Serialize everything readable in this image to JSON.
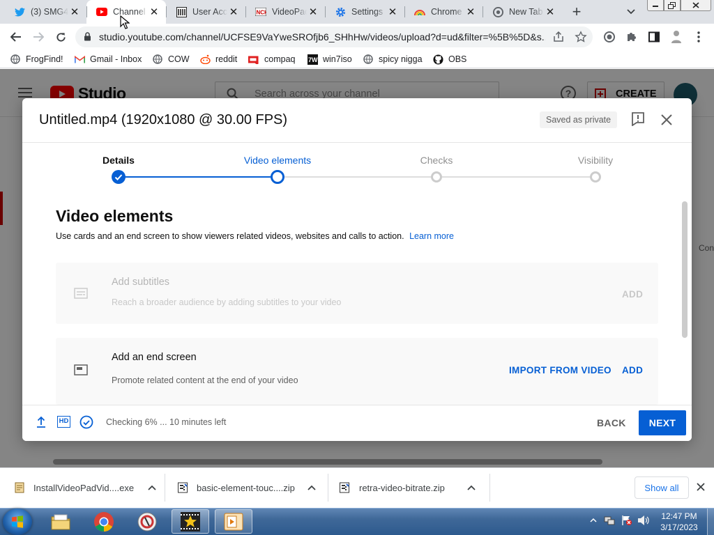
{
  "browser": {
    "tabs": [
      {
        "title": "(3) SMG4",
        "icon": "twitter-icon"
      },
      {
        "title": "Channel",
        "icon": "youtube-icon"
      },
      {
        "title": "User Acc",
        "icon": "library-icon"
      },
      {
        "title": "VideoPad",
        "icon": "nch-icon"
      },
      {
        "title": "Settings",
        "icon": "settings-gear-icon"
      },
      {
        "title": "Chrome",
        "icon": "chrome-rainbow-icon"
      },
      {
        "title": "New Tab",
        "icon": "chrome-icon"
      }
    ],
    "url": "studio.youtube.com/channel/UCFSE9VaYweSROfjb6_SHhHw/videos/upload?d=ud&filter=%5B%5D&s...",
    "bookmarks": [
      {
        "label": "FrogFind!",
        "icon": "globe-icon"
      },
      {
        "label": "Gmail - Inbox",
        "icon": "gmail-icon"
      },
      {
        "label": "COW",
        "icon": "globe-icon"
      },
      {
        "label": "reddit",
        "icon": "reddit-icon"
      },
      {
        "label": "compaq",
        "icon": "compaq-icon"
      },
      {
        "label": "win7iso",
        "icon": "win7iso-icon"
      },
      {
        "label": "spicy nigga",
        "icon": "globe-icon"
      },
      {
        "label": "OBS",
        "icon": "github-icon"
      }
    ]
  },
  "studio": {
    "logo_text": "Studio",
    "search_placeholder": "Search across your channel",
    "create_label": "CREATE",
    "side_peek": "Con"
  },
  "dialog": {
    "title": "Untitled.mp4 (1920x1080 @ 30.00 FPS)",
    "saved_badge": "Saved as private",
    "steps": [
      {
        "label": "Details",
        "state": "done"
      },
      {
        "label": "Video elements",
        "state": "current"
      },
      {
        "label": "Checks",
        "state": "pending"
      },
      {
        "label": "Visibility",
        "state": "pending"
      }
    ],
    "section_title": "Video elements",
    "section_desc": "Use cards and an end screen to show viewers related videos, websites and calls to action.",
    "learn_more": "Learn more",
    "cards": [
      {
        "title": "Add subtitles",
        "desc": "Reach a broader audience by adding subtitles to your video",
        "action": "ADD",
        "disabled": true
      },
      {
        "title": "Add an end screen",
        "desc": "Promote related content at the end of your video",
        "secondary_action": "IMPORT FROM VIDEO",
        "action": "ADD",
        "disabled": false
      }
    ],
    "footer": {
      "status": "Checking 6% ... 10 minutes left",
      "back": "BACK",
      "next": "NEXT"
    }
  },
  "downloads": {
    "items": [
      {
        "name": "InstallVideoPadVid....exe"
      },
      {
        "name": "basic-element-touc....zip"
      },
      {
        "name": "retra-video-bitrate.zip"
      }
    ],
    "show_all": "Show all"
  },
  "taskbar": {
    "time": "12:47 PM",
    "date": "3/17/2023"
  },
  "colors": {
    "accent": "#065fd4",
    "progress_done": "#065fd4",
    "youtube_red": "#ff0000"
  }
}
